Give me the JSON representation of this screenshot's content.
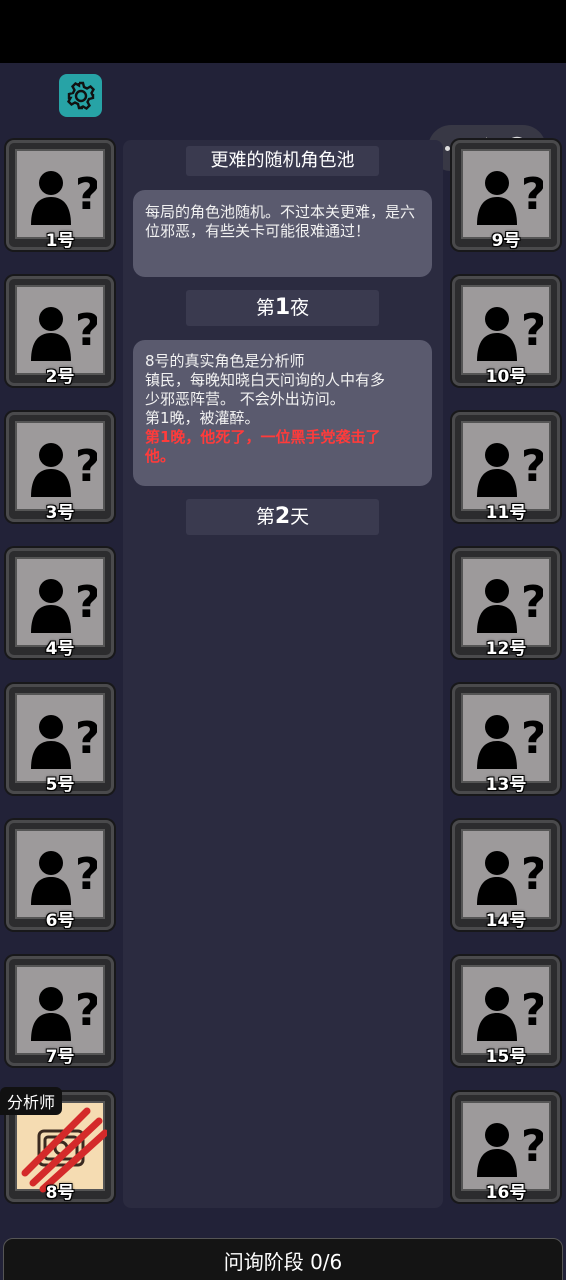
{
  "toolbar": {
    "settings_icon": "gear-icon",
    "menu_icon": "more-dots-icon",
    "close_icon": "target-circle-icon"
  },
  "title": "更难的随机角色池",
  "intro_message": "每局的角色池随机。不过本关更难，是六位邪恶，有些关卡可能很难通过！",
  "night1": {
    "prefix": "第",
    "num": "1",
    "suffix": "夜"
  },
  "night_message": {
    "line1": "8号的真实角色是分析师",
    "line2": "镇民，每晚知晓白天问询的人中有多",
    "line3": "少邪恶阵营。 不会外出访问。",
    "line4": "第1晚，被灌醉。",
    "red_line1": "第1晚，他死了，一位黑手党袭击了",
    "red_line2": "他。"
  },
  "day2": {
    "prefix": "第",
    "num": "2",
    "suffix": "天"
  },
  "left_players": [
    {
      "label": "1号"
    },
    {
      "label": "2号"
    },
    {
      "label": "3号"
    },
    {
      "label": "4号"
    },
    {
      "label": "5号"
    },
    {
      "label": "6号"
    },
    {
      "label": "7号"
    },
    {
      "label": "8号",
      "role": "分析师",
      "dead": true
    }
  ],
  "right_players": [
    {
      "label": "9号"
    },
    {
      "label": "10号"
    },
    {
      "label": "11号"
    },
    {
      "label": "12号"
    },
    {
      "label": "13号"
    },
    {
      "label": "14号"
    },
    {
      "label": "15号"
    },
    {
      "label": "16号"
    }
  ],
  "phase_bar": "问询阶段 0/6",
  "colors": {
    "background": "#222238",
    "accent": "#27a3a6",
    "death": "#ff3b3b"
  }
}
